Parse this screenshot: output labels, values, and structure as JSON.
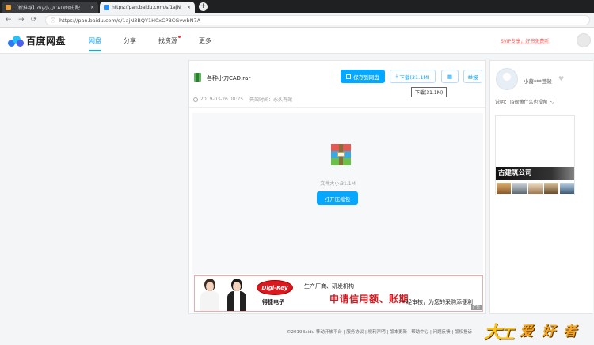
{
  "browser": {
    "tabs": [
      {
        "title": "【新推荐】diy小刀CAD图纸 配",
        "close": "×",
        "favicon_color": "#e9a23b",
        "active": false
      },
      {
        "title": "https://pan.baidu.com/s/1ajN",
        "close": "×",
        "favicon_color": "#2d8cf0",
        "active": true
      }
    ],
    "new_tab": "+",
    "nav": {
      "back": "←",
      "forward": "→",
      "reload": "⟳"
    },
    "url": "https://pan.baidu.com/s/1ajN3BQY1H0xCPBCGvwbN7A",
    "lock_icon": "ⓘ"
  },
  "site": {
    "logo_text": "百度网盘",
    "nav": [
      {
        "label": "网盘",
        "active": true
      },
      {
        "label": "分享",
        "active": false
      },
      {
        "label": "找资源",
        "active": false,
        "dot": true
      },
      {
        "label": "更多",
        "active": false
      }
    ],
    "svip_link": "SVIP专享，好书免费听"
  },
  "file": {
    "name": "各种小刀CAD.rar",
    "save_button": "保存到网盘",
    "download_button": "下载(31.1M)",
    "qr_button": "▦",
    "report_button": "举报",
    "tooltip": "下载(31.1M)",
    "date": "2019-03-26 08:25",
    "expiry": "失效时间：永久有效",
    "size_label": "文件大小:31.1M",
    "open_button": "打开压缩包"
  },
  "ad_banner": {
    "logo": "Digi-Key",
    "brand": "得捷电子",
    "line1": "生产厂商、研发机构",
    "line2": "申请信用额、账期",
    "line3": "一经审核，为您的采购添便利",
    "tag": "广告"
  },
  "owner": {
    "name": "小蔷***荳殻",
    "description": "说明：Ta很懒什么也没留下。",
    "heart_icon": "♥"
  },
  "side_ad": {
    "title": "古建筑公司"
  },
  "footer": {
    "text": "©2019Baidu 移动开放平台 | 服务协议 | 权利声明 | 版本更新 | 帮助中心 | 问题反馈 | 版权投诉"
  },
  "watermark": {
    "chars": [
      "大",
      "工",
      "爱",
      "好",
      "者"
    ]
  },
  "colors": {
    "accent": "#06a7ff",
    "ad_red": "#d71920",
    "svip": "#ff5555"
  }
}
